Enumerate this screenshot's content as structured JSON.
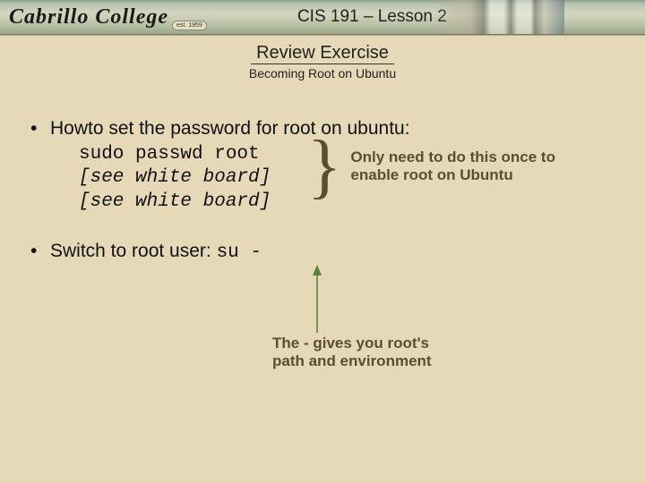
{
  "banner": {
    "logo_text": "Cabrillo College",
    "est_text": "est. 1959",
    "course_title": "CIS 191 – Lesson 2"
  },
  "heading": {
    "main": "Review Exercise",
    "sub": "Becoming Root on Ubuntu"
  },
  "bullets": {
    "first": "Howto set the password for root on ubuntu:",
    "code": {
      "line1": "sudo passwd root",
      "line2": "[see white board]",
      "line3": "[see white board]"
    },
    "brace_note": "Only need to do this once to enable root on Ubuntu",
    "second_prefix": "Switch to root user:  ",
    "second_code": "su -",
    "arrow_note_line1": "The - gives you root's",
    "arrow_note_line2": "path and environment"
  },
  "colors": {
    "accent_text": "#5c4f2e",
    "arrow": "#58803a"
  }
}
